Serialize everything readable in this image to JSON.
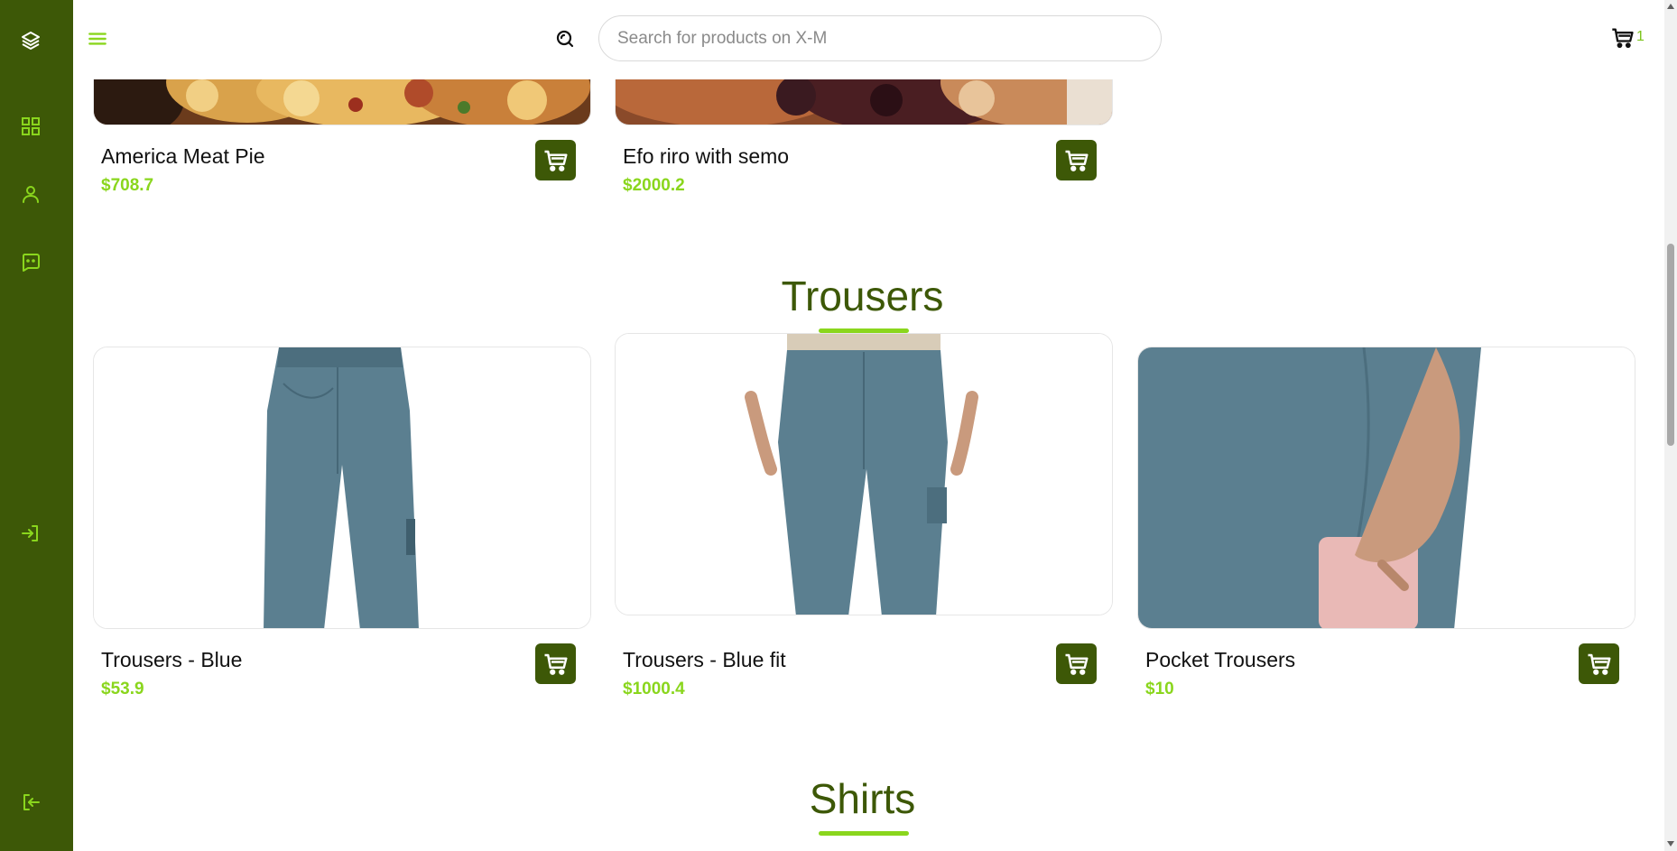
{
  "header": {
    "search_placeholder": "Search for products on X-M",
    "cart_count": "1"
  },
  "sidebar": {
    "items": [
      {
        "icon": "layers-icon"
      },
      {
        "icon": "dashboard-grid-icon"
      },
      {
        "icon": "user-icon"
      },
      {
        "icon": "chat-bot-icon"
      },
      {
        "icon": "login-icon"
      },
      {
        "icon": "logout-icon"
      }
    ]
  },
  "sections": {
    "food": {
      "products": [
        {
          "name": "America Meat Pie",
          "price": "$708.7"
        },
        {
          "name": "Efo riro with semo",
          "price": "$2000.2"
        }
      ]
    },
    "trousers": {
      "title": "Trousers",
      "products": [
        {
          "name": "Trousers - Blue",
          "price": "$53.9"
        },
        {
          "name": "Trousers - Blue fit",
          "price": "$1000.4"
        },
        {
          "name": "Pocket Trousers",
          "price": "$10"
        }
      ]
    },
    "shirts": {
      "title": "Shirts"
    }
  },
  "colors": {
    "brand_dark": "#3d5807",
    "accent_green": "#8ad61d",
    "trouser_blue": "#5b7f90"
  }
}
